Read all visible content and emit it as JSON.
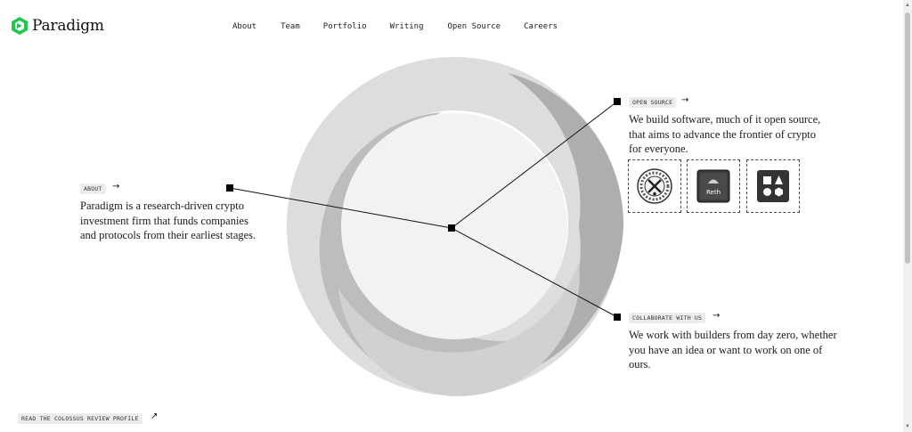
{
  "brand": {
    "name": "Paradigm",
    "color": "#1fc84a"
  },
  "nav": {
    "items": [
      "About",
      "Team",
      "Portfolio",
      "Writing",
      "Open Source",
      "Careers"
    ]
  },
  "about": {
    "tag": "ABOUT",
    "text": "Paradigm is a research-driven crypto investment firm that funds companies and protocols from their earliest stages."
  },
  "open_source": {
    "tag": "OPEN SOURCE",
    "text": "We build software, much of it open source, that aims to advance the frontier of crypto for everyone.",
    "projects": [
      {
        "icon": "foundry-icon"
      },
      {
        "icon": "reth-icon",
        "label": "Reth"
      },
      {
        "icon": "shapes-icon"
      }
    ]
  },
  "collaborate": {
    "tag": "COLLABORATE WITH US",
    "text": "We work with builders from day zero, whether you have an idea or want to work on one of ours."
  },
  "footer": {
    "link": "READ THE COLOSSUS REVIEW PROFILE"
  }
}
